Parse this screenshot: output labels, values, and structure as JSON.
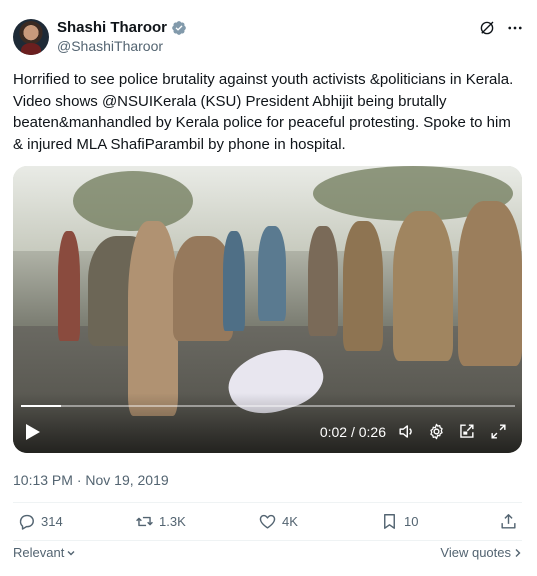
{
  "author": {
    "name": "Shashi Tharoor",
    "handle": "@ShashiTharoor",
    "verified_icon": "verified-badge-icon"
  },
  "tweet": {
    "text": "Horrified to see police brutality against youth activists &politicians in Kerala. Video shows @NSUIKerala (KSU) President Abhijit being brutally beaten&manhandled by Kerala police for peaceful protesting. Spoke to him & injured MLA ShafiParambil by phone in hospital.",
    "timestamp": "10:13 PM · Nov 19, 2019"
  },
  "video": {
    "time": "0:02 / 0:26",
    "progress": 0.08
  },
  "stats": {
    "replies": "314",
    "retweets": "1.3K",
    "likes": "4K",
    "bookmarks": "10"
  },
  "footer": {
    "sort_label": "Relevant",
    "view_quotes": "View quotes"
  },
  "colors": {
    "text": "#0f1419",
    "muted": "#536471",
    "verified": "#829aab"
  }
}
